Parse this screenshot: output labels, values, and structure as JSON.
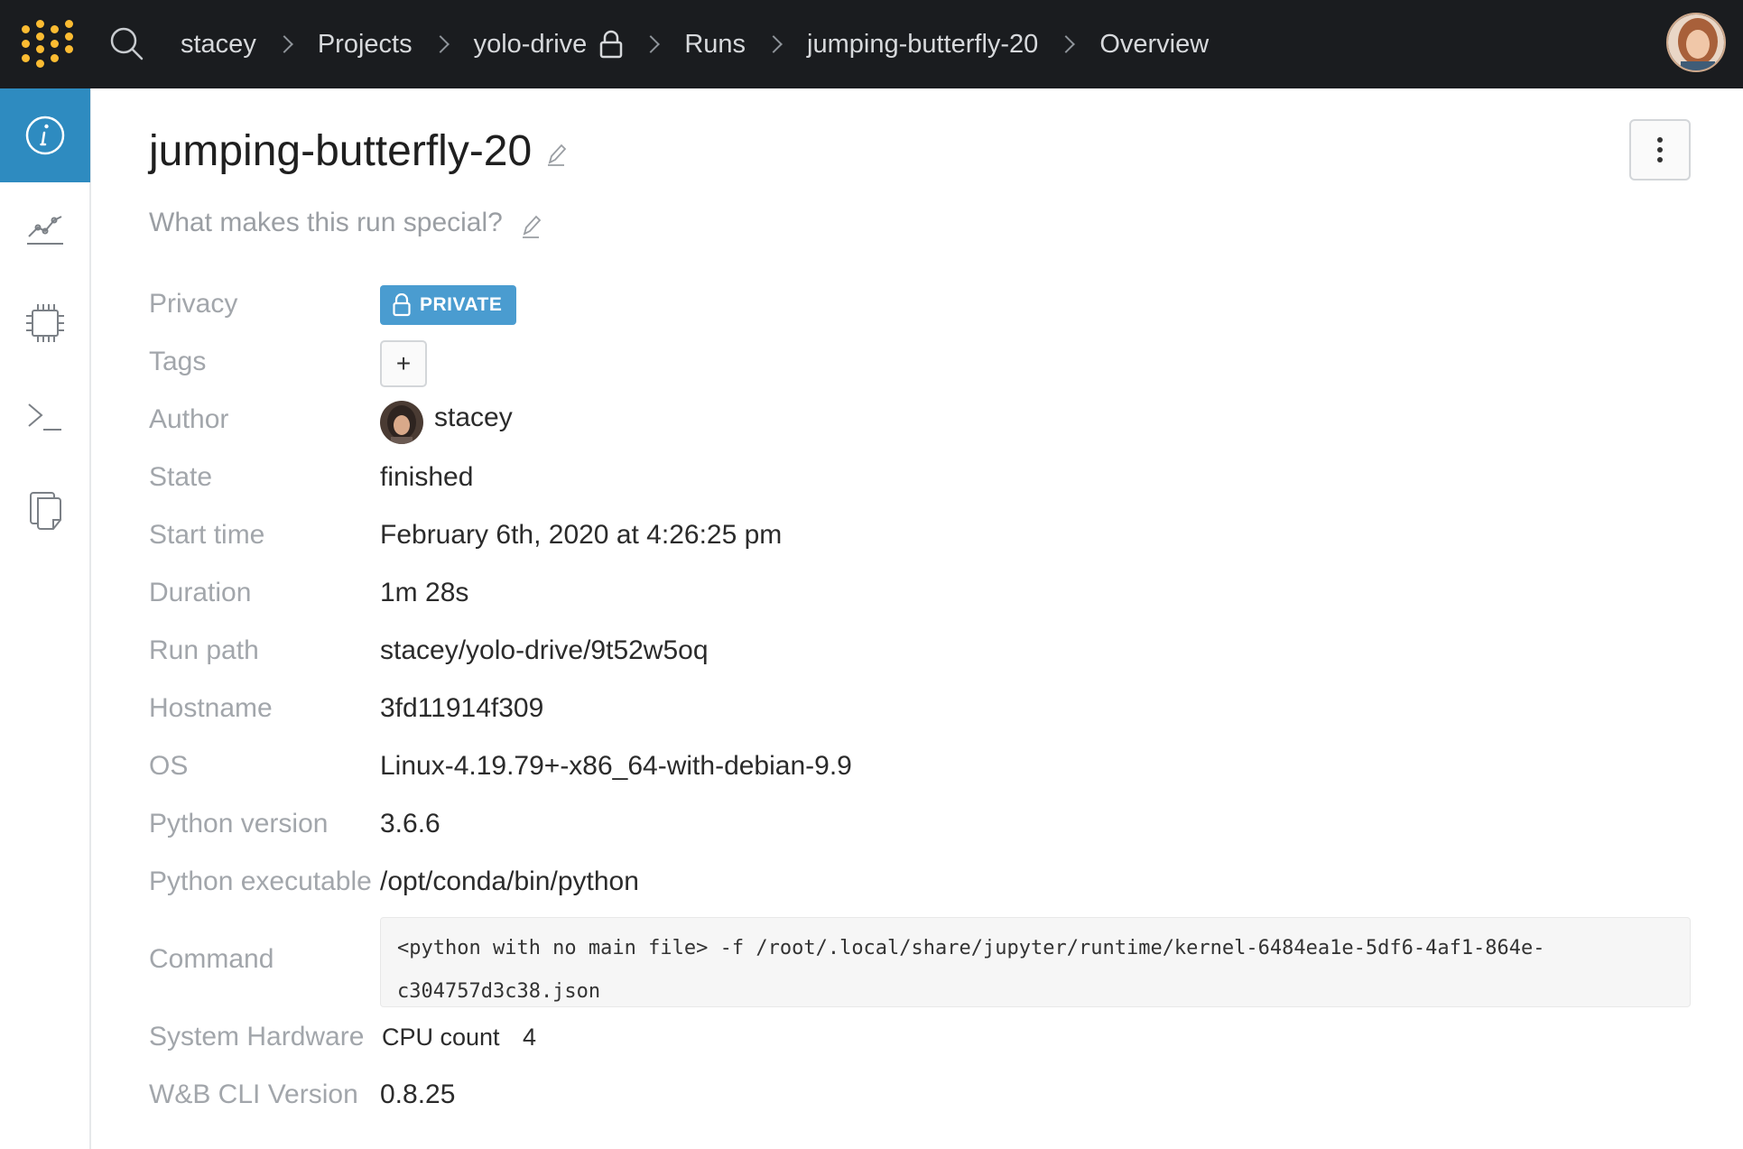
{
  "breadcrumb": {
    "items": [
      "stacey",
      "Projects",
      "yolo-drive",
      "Runs",
      "jumping-butterfly-20",
      "Overview"
    ]
  },
  "run": {
    "name": "jumping-butterfly-20",
    "description_placeholder": "What makes this run special?"
  },
  "details": {
    "privacy_label": "Privacy",
    "privacy_value": "PRIVATE",
    "tags_label": "Tags",
    "tags_add": "+",
    "author_label": "Author",
    "author_value": "stacey",
    "state_label": "State",
    "state_value": "finished",
    "start_label": "Start time",
    "start_value": "February 6th, 2020 at 4:26:25 pm",
    "duration_label": "Duration",
    "duration_value": "1m 28s",
    "runpath_label": "Run path",
    "runpath_value": "stacey/yolo-drive/9t52w5oq",
    "hostname_label": "Hostname",
    "hostname_value": "3fd11914f309",
    "os_label": "OS",
    "os_value": "Linux-4.19.79+-x86_64-with-debian-9.9",
    "pyver_label": "Python version",
    "pyver_value": "3.6.6",
    "pyexe_label": "Python executable",
    "pyexe_value": "/opt/conda/bin/python",
    "command_label": "Command",
    "command_line1": "<python with no main file> -f /root/.local/share/jupyter/runtime/kernel-6484ea1e-5df6-4af1-864e-",
    "command_line2": "c304757d3c38.json",
    "hw_label": "System Hardware",
    "hw_key": "CPU count",
    "hw_value": "4",
    "cli_label": "W&B CLI Version",
    "cli_value": "0.8.25"
  },
  "colors": {
    "topbar": "#1a1c1f",
    "accent": "#2e8bc0",
    "badge": "#4a9cd0",
    "logo": "#fcbc32"
  },
  "icons": {
    "sidebar": [
      "info-icon",
      "chart-icon",
      "chip-icon",
      "terminal-icon",
      "files-icon"
    ]
  }
}
